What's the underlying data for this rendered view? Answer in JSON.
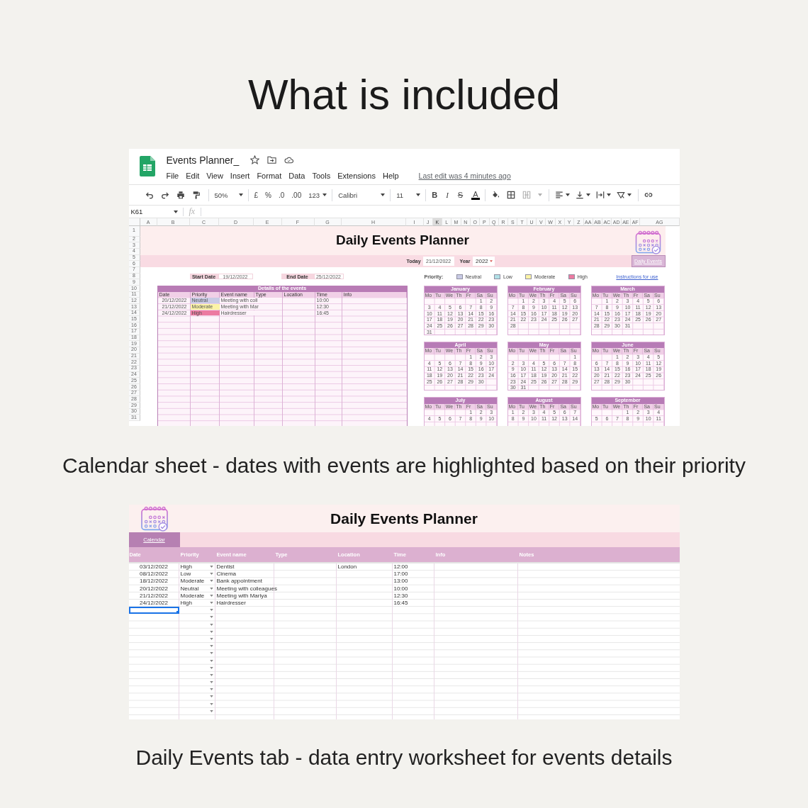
{
  "heading": "What is included",
  "calendar_screenshot": {
    "document_title": "Events Planner_",
    "menu": [
      "File",
      "Edit",
      "View",
      "Insert",
      "Format",
      "Data",
      "Tools",
      "Extensions",
      "Help"
    ],
    "last_edit": "Last edit was 4 minutes ago",
    "toolbar": {
      "zoom": "50%",
      "currency": "£",
      "percent": "%",
      "decrease_decimals": ".0",
      "increase_decimals": ".00",
      "number_format": "123",
      "font": "Calibri",
      "font_size": "11",
      "bold": "B",
      "italic": "I",
      "strikethrough": "S",
      "text_color": "A"
    },
    "name_box": "K61",
    "formula_label": "fx",
    "columns": [
      {
        "label": "A",
        "selected": false
      },
      {
        "label": "B",
        "selected": false
      },
      {
        "label": "C",
        "selected": false
      },
      {
        "label": "D",
        "selected": false
      },
      {
        "label": "E",
        "selected": false
      },
      {
        "label": "F",
        "selected": false
      },
      {
        "label": "G",
        "selected": false
      },
      {
        "label": "H",
        "selected": false
      },
      {
        "label": "I",
        "selected": false
      },
      {
        "label": "J",
        "selected": false
      },
      {
        "label": "K",
        "selected": true
      },
      {
        "label": "L",
        "selected": false
      },
      {
        "label": "M",
        "selected": false
      },
      {
        "label": "N",
        "selected": false
      },
      {
        "label": "O",
        "selected": false
      },
      {
        "label": "P",
        "selected": false
      },
      {
        "label": "Q",
        "selected": false
      },
      {
        "label": "R",
        "selected": false
      },
      {
        "label": "S",
        "selected": false
      },
      {
        "label": "T",
        "selected": false
      },
      {
        "label": "U",
        "selected": false
      },
      {
        "label": "V",
        "selected": false
      },
      {
        "label": "W",
        "selected": false
      },
      {
        "label": "X",
        "selected": false
      },
      {
        "label": "Y",
        "selected": false
      },
      {
        "label": "Z",
        "selected": false
      },
      {
        "label": "AA",
        "selected": false
      },
      {
        "label": "AB",
        "selected": false
      },
      {
        "label": "AC",
        "selected": false
      },
      {
        "label": "AD",
        "selected": false
      },
      {
        "label": "AE",
        "selected": false
      },
      {
        "label": "AF",
        "selected": false
      },
      {
        "label": "AG",
        "selected": false
      }
    ],
    "rows": [
      "1",
      "2",
      "3",
      "4",
      "5",
      "6",
      "7",
      "8",
      "9",
      "10",
      "11",
      "12",
      "13",
      "14",
      "15",
      "16",
      "17",
      "18",
      "19",
      "20",
      "21",
      "22",
      "23",
      "24",
      "25",
      "26",
      "27",
      "28",
      "29",
      "30",
      "31"
    ],
    "sheet": {
      "title": "Daily Events Planner",
      "today_label": "Today",
      "today": "21/12/2022",
      "year_label": "Year",
      "year": "2022",
      "daily_events_link": "Daily Events",
      "start_date_label": "Start Date",
      "start_date": "19/12/2022",
      "end_date_label": "End Date",
      "end_date": "25/12/2022",
      "priority_label": "Priority:",
      "priorities": [
        {
          "label": "Neutral",
          "color": "#c9cbe5"
        },
        {
          "label": "Low",
          "color": "#b1e0e6"
        },
        {
          "label": "Moderate",
          "color": "#fbf3a6"
        },
        {
          "label": "High",
          "color": "#ec7aa1"
        }
      ],
      "instructions_link": "Instructions for use",
      "events_table": {
        "title": "Details of the events",
        "columns": [
          "Date",
          "Priority",
          "Event name",
          "Type",
          "Location",
          "Time",
          "Info"
        ],
        "rows": [
          {
            "date": "20/12/2022",
            "priority": "Neutral",
            "color": "#c9cbe5",
            "event_name": "Meeting with coll",
            "time": "10:00"
          },
          {
            "date": "21/12/2022",
            "priority": "Moderate",
            "color": "#fbf3a6",
            "event_name": "Meeting with Mar",
            "time": "12:30"
          },
          {
            "date": "24/12/2022",
            "priority": "High",
            "color": "#ec7aa1",
            "event_name": "Hairdresser",
            "time": "16:45"
          }
        ]
      },
      "months": [
        {
          "name": "January",
          "day_names": [
            "Mo",
            "Tu",
            "We",
            "Th",
            "Fr",
            "Sa",
            "Su"
          ],
          "weeks": [
            [
              "1",
              "2"
            ],
            [
              "3",
              "4",
              "5",
              "6",
              "7",
              "8",
              "9"
            ],
            [
              "10",
              "11",
              "12",
              "13",
              "14",
              "15",
              "16"
            ],
            [
              "17",
              "18",
              "19",
              "20",
              "21",
              "22",
              "23"
            ],
            [
              "24",
              "25",
              "26",
              "27",
              "28",
              "29",
              "30"
            ],
            [
              "31"
            ]
          ]
        },
        {
          "name": "February",
          "day_names": [
            "Mo",
            "Tu",
            "We",
            "Th",
            "Fr",
            "Sa",
            "Su"
          ],
          "weeks": [
            [
              "1",
              "2",
              "3",
              "4",
              "5",
              "6"
            ],
            [
              "7",
              "8",
              "9",
              "10",
              "11",
              "12",
              "13"
            ],
            [
              "14",
              "15",
              "16",
              "17",
              "18",
              "19",
              "20"
            ],
            [
              "21",
              "22",
              "23",
              "24",
              "25",
              "26",
              "27"
            ],
            [
              "28"
            ]
          ]
        },
        {
          "name": "March",
          "day_names": [
            "Mo",
            "Tu",
            "We",
            "Th",
            "Fr",
            "Sa",
            "Su"
          ],
          "weeks": [
            [
              "1",
              "2",
              "3",
              "4",
              "5",
              "6"
            ],
            [
              "7",
              "8",
              "9",
              "10",
              "11",
              "12",
              "13"
            ],
            [
              "14",
              "15",
              "16",
              "17",
              "18",
              "19",
              "20"
            ],
            [
              "21",
              "22",
              "23",
              "24",
              "25",
              "26",
              "27"
            ],
            [
              "28",
              "29",
              "30",
              "31"
            ]
          ]
        },
        {
          "name": "April",
          "day_names": [
            "Mo",
            "Tu",
            "We",
            "Th",
            "Fr",
            "Sa",
            "Su"
          ],
          "weeks": [
            [
              "1",
              "2",
              "3"
            ],
            [
              "4",
              "5",
              "6",
              "7",
              "8",
              "9",
              "10"
            ],
            [
              "11",
              "12",
              "13",
              "14",
              "15",
              "16",
              "17"
            ],
            [
              "18",
              "19",
              "20",
              "21",
              "22",
              "23",
              "24"
            ],
            [
              "25",
              "26",
              "27",
              "28",
              "29",
              "30"
            ]
          ]
        },
        {
          "name": "May",
          "day_names": [
            "Mo",
            "Tu",
            "We",
            "Th",
            "Fr",
            "Sa",
            "Su"
          ],
          "weeks": [
            [
              "1"
            ],
            [
              "2",
              "3",
              "4",
              "5",
              "6",
              "7",
              "8"
            ],
            [
              "9",
              "10",
              "11",
              "12",
              "13",
              "14",
              "15"
            ],
            [
              "16",
              "17",
              "18",
              "19",
              "20",
              "21",
              "22"
            ],
            [
              "23",
              "24",
              "25",
              "26",
              "27",
              "28",
              "29"
            ],
            [
              "30",
              "31"
            ]
          ]
        },
        {
          "name": "June",
          "day_names": [
            "Mo",
            "Tu",
            "We",
            "Th",
            "Fr",
            "Sa",
            "Su"
          ],
          "weeks": [
            [
              "1",
              "2",
              "3",
              "4",
              "5"
            ],
            [
              "6",
              "7",
              "8",
              "9",
              "10",
              "11",
              "12"
            ],
            [
              "13",
              "14",
              "15",
              "16",
              "17",
              "18",
              "19"
            ],
            [
              "20",
              "21",
              "22",
              "23",
              "24",
              "25",
              "26"
            ],
            [
              "27",
              "28",
              "29",
              "30"
            ]
          ]
        },
        {
          "name": "July",
          "day_names": [
            "Mo",
            "Tu",
            "We",
            "Th",
            "Fr",
            "Sa",
            "Su"
          ],
          "weeks": [
            [
              "1",
              "2",
              "3"
            ],
            [
              "4",
              "5",
              "6",
              "7",
              "8",
              "9",
              "10"
            ]
          ]
        },
        {
          "name": "August",
          "day_names": [
            "Mo",
            "Tu",
            "We",
            "Th",
            "Fr",
            "Sa",
            "Su"
          ],
          "weeks": [
            [
              "1",
              "2",
              "3",
              "4",
              "5",
              "6",
              "7"
            ],
            [
              "8",
              "9",
              "10",
              "11",
              "12",
              "13",
              "14"
            ]
          ]
        },
        {
          "name": "September",
          "day_names": [
            "Mo",
            "Tu",
            "We",
            "Th",
            "Fr",
            "Sa",
            "Su"
          ],
          "weeks": [
            [
              "1",
              "2",
              "3",
              "4"
            ],
            [
              "5",
              "6",
              "7",
              "8",
              "9",
              "10",
              "11"
            ]
          ]
        }
      ]
    }
  },
  "calendar_caption": "Calendar sheet - dates with events are highlighted based on their priority",
  "daily_events_screenshot": {
    "title": "Daily Events Planner",
    "calendar_link": "Calendar",
    "columns": [
      "Date",
      "Priority",
      "Event name",
      "Type",
      "Location",
      "Time",
      "Info",
      "Notes"
    ],
    "rows": [
      {
        "date": "03/12/2022",
        "priority": "High",
        "event_name": "Dentist",
        "location": "London",
        "time": "12:00"
      },
      {
        "date": "08/12/2022",
        "priority": "Low",
        "event_name": "Cinema",
        "time": "17:00"
      },
      {
        "date": "18/12/2022",
        "priority": "Moderate",
        "event_name": "Bank appointment",
        "time": "13:00"
      },
      {
        "date": "20/12/2022",
        "priority": "Neutral",
        "event_name": "Meeting with colleagues",
        "time": "10:00"
      },
      {
        "date": "21/12/2022",
        "priority": "Moderate",
        "event_name": "Meeting with Mariya",
        "time": "12:30"
      },
      {
        "date": "24/12/2022",
        "priority": "High",
        "event_name": "Hairdresser",
        "time": "16:45"
      }
    ],
    "blank_rows": [
      {
        "selected": true
      },
      {
        "selected": false
      },
      {
        "selected": false
      },
      {
        "selected": false
      },
      {
        "selected": false
      },
      {
        "selected": false
      },
      {
        "selected": false
      },
      {
        "selected": false
      },
      {
        "selected": false
      },
      {
        "selected": false
      },
      {
        "selected": false
      },
      {
        "selected": false
      },
      {
        "selected": false
      },
      {
        "selected": false
      },
      {
        "selected": false
      }
    ]
  },
  "daily_events_caption": "Daily Events tab - data entry worksheet for events details"
}
